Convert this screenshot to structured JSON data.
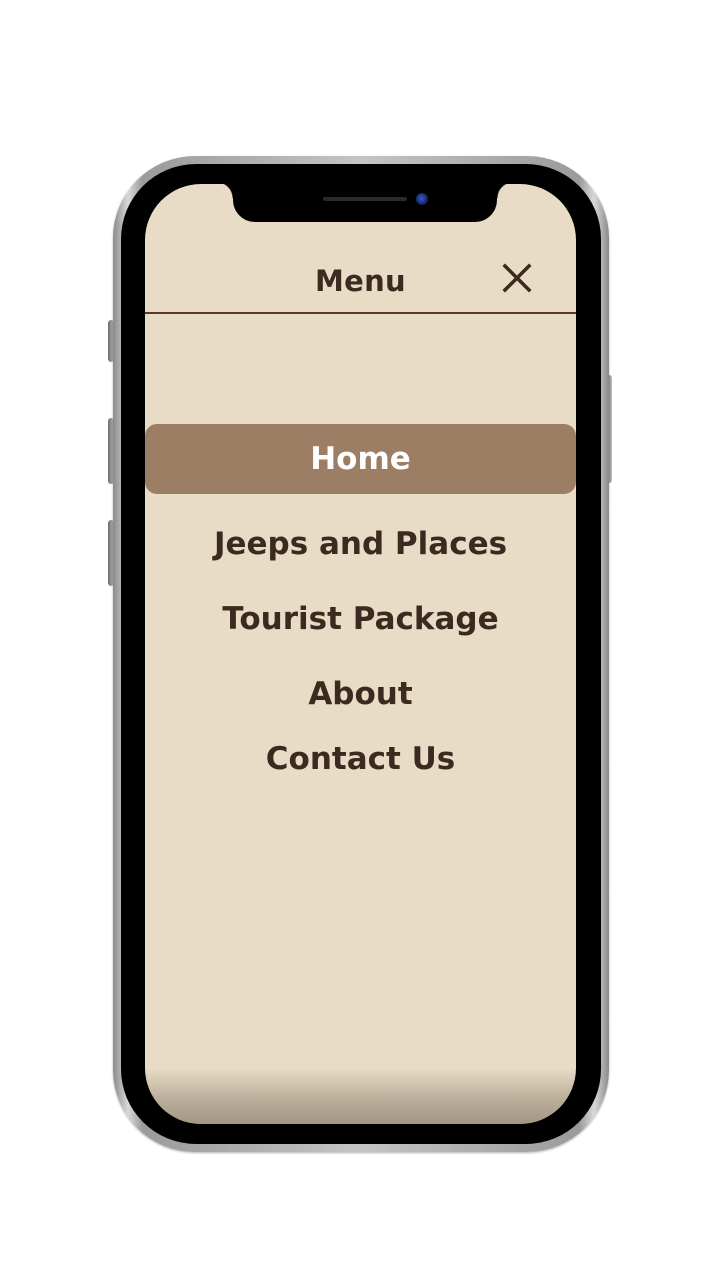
{
  "header": {
    "title": "Menu",
    "close_icon": "close-icon"
  },
  "nav": {
    "items": [
      {
        "label": "Home",
        "active": true
      },
      {
        "label": "Jeeps and Places",
        "active": false
      },
      {
        "label": "Tourist Package",
        "active": false
      },
      {
        "label": "About",
        "active": false
      },
      {
        "label": "Contact Us",
        "active": false
      }
    ]
  },
  "colors": {
    "screen_background": "#e8dcc6",
    "active_item_background": "#9c7e65",
    "text": "#3b2a1f",
    "active_text": "#ffffff",
    "divider": "#5a3a22"
  }
}
